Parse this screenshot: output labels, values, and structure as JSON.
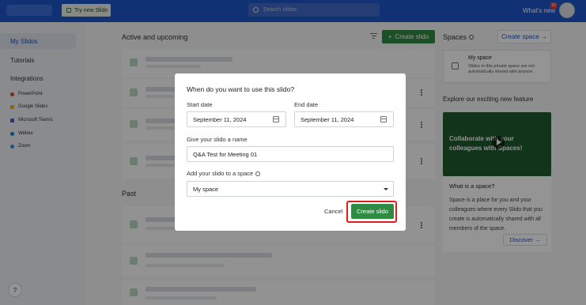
{
  "topbar": {
    "try_button": "Try new Slido",
    "search_placeholder": "Search slidos",
    "whats_new": "What's new",
    "notification_count": "16"
  },
  "sidebar": {
    "items": [
      {
        "label": "My Slidos",
        "active": true
      },
      {
        "label": "Tutorials"
      },
      {
        "label": "Integrations"
      }
    ],
    "integrations": [
      {
        "label": "PowerPoint",
        "color": "#d24726"
      },
      {
        "label": "Google Slides",
        "color": "#f4b400"
      },
      {
        "label": "Microsoft Teams",
        "color": "#5059c9"
      },
      {
        "label": "Webex",
        "color": "#1e7fd0"
      },
      {
        "label": "Zoom",
        "color": "#2d8cff"
      }
    ],
    "help": "?"
  },
  "main": {
    "active_title": "Active and upcoming",
    "create_button": "Create slido",
    "past_title": "Past"
  },
  "right": {
    "spaces_title": "Spaces",
    "create_space": "Create space →",
    "my_space_title": "My space",
    "my_space_desc": "Slidos in this private space are not automatically shared with anyone.",
    "explore": "Explore our exciting new feature",
    "video_text": "Collaborate with your colleagues with Spaces!",
    "what_is": "What is a space?",
    "what_is_desc": "Space is a place for you and your colleagues where every Slido that you create is automatically shared with all members of the space.",
    "discover": "Discover →"
  },
  "modal": {
    "title": "When do you want to use this slido?",
    "start_label": "Start date",
    "start_value": "September 11, 2024",
    "end_label": "End date",
    "end_value": "September 11, 2024",
    "name_label": "Give your slido a name",
    "name_value": "Q&A Test for Meeting 01",
    "space_label": "Add your slido to a space",
    "space_value": "My space",
    "cancel": "Cancel",
    "create": "Create slido"
  }
}
